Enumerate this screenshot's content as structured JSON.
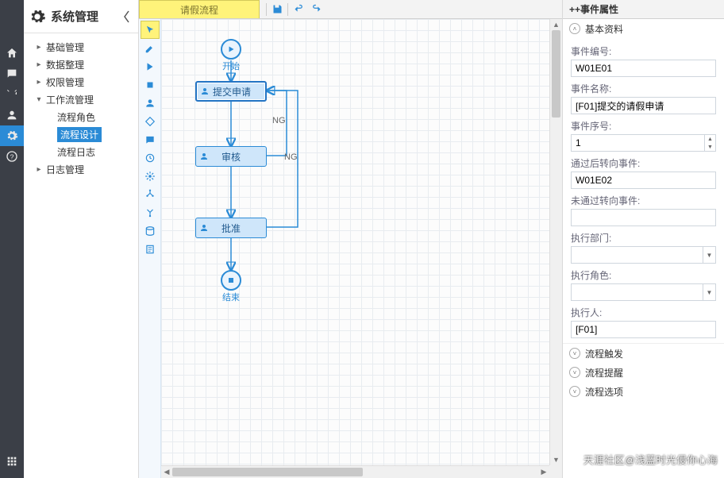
{
  "iconstrip": {
    "items": [
      "home",
      "chat",
      "tools",
      "user",
      "gear",
      "help"
    ],
    "selected": 4
  },
  "sidebar": {
    "title": "系统管理",
    "nodes": [
      {
        "label": "基础管理",
        "expanded": false
      },
      {
        "label": "数据整理",
        "expanded": false
      },
      {
        "label": "权限管理",
        "expanded": false
      },
      {
        "label": "工作流管理",
        "expanded": true,
        "children": [
          {
            "label": "流程角色"
          },
          {
            "label": "流程设计",
            "selected": true
          },
          {
            "label": "流程日志"
          }
        ]
      },
      {
        "label": "日志管理",
        "expanded": false
      }
    ]
  },
  "tab": {
    "label": "请假流程"
  },
  "flow": {
    "start": "开始",
    "end": "结束",
    "submit": "提交申请",
    "review": "审核",
    "approve": "批准",
    "ng": "NG"
  },
  "props": {
    "header": "++事件属性",
    "section_basic": "基本资料",
    "event_no_label": "事件编号:",
    "event_no": "W01E01",
    "event_name_label": "事件名称:",
    "event_name": "[F01]提交的请假申请",
    "event_seq_label": "事件序号:",
    "event_seq": "1",
    "pass_to_label": "通过后转向事件:",
    "pass_to": "W01E02",
    "fail_to_label": "未通过转向事件:",
    "fail_to": "",
    "dept_label": "执行部门:",
    "dept": "",
    "role_label": "执行角色:",
    "role": "",
    "exec_label": "执行人:",
    "exec": "[F01]",
    "section_trigger": "流程触发",
    "section_remind": "流程提醒",
    "section_options": "流程选项"
  },
  "watermark": "天涯社区@浅蓝时光侵你心海"
}
